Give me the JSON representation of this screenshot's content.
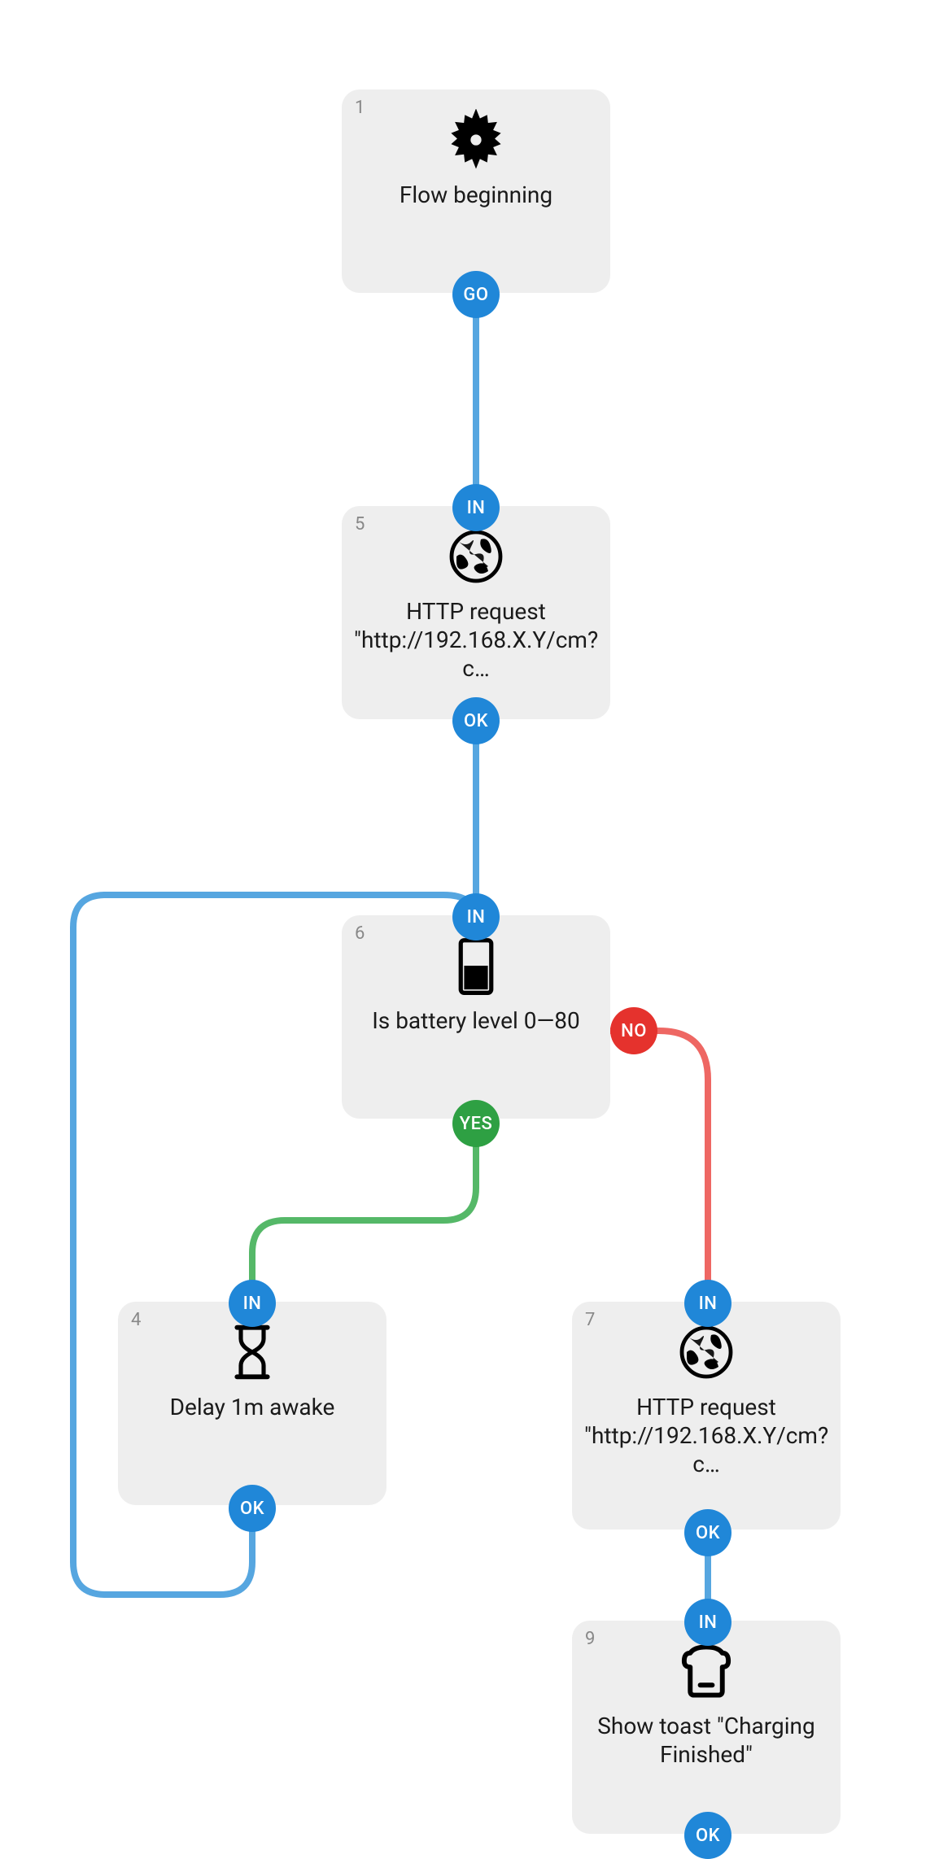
{
  "nodes": {
    "n1": {
      "id": "1",
      "label": "Flow beginning"
    },
    "n5": {
      "id": "5",
      "label": "HTTP request \"http://192.168.X.Y/cm?c…"
    },
    "n6": {
      "id": "6",
      "label": "Is battery level 0—80"
    },
    "n4": {
      "id": "4",
      "label": "Delay 1m awake"
    },
    "n7": {
      "id": "7",
      "label": "HTTP request \"http://192.168.X.Y/cm?c…"
    },
    "n9": {
      "id": "9",
      "label": "Show toast \"Charging Finished\""
    }
  },
  "badges": {
    "go": "GO",
    "in": "IN",
    "ok": "OK",
    "yes": "YES",
    "no": "NO"
  },
  "colors": {
    "blue": "#2087d8",
    "green": "#2ea043",
    "red": "#e5322d",
    "nodeBg": "#eeeeee"
  },
  "diagram": {
    "description": "Automation flow: start → HTTP request → check battery level 0-80. If YES → delay 1m awake → loop back to battery check. If NO → HTTP request → show toast 'Charging Finished'.",
    "edges": [
      {
        "from": "1",
        "to": "5",
        "out": "GO",
        "in": "IN",
        "color": "blue"
      },
      {
        "from": "5",
        "to": "6",
        "out": "OK",
        "in": "IN",
        "color": "blue"
      },
      {
        "from": "6",
        "to": "4",
        "out": "YES",
        "in": "IN",
        "color": "green"
      },
      {
        "from": "6",
        "to": "7",
        "out": "NO",
        "in": "IN",
        "color": "red"
      },
      {
        "from": "4",
        "to": "6",
        "out": "OK",
        "in": "IN",
        "color": "blue"
      },
      {
        "from": "7",
        "to": "9",
        "out": "OK",
        "in": "IN",
        "color": "blue"
      },
      {
        "from": "9",
        "to": null,
        "out": "OK",
        "in": null,
        "color": "blue"
      }
    ]
  }
}
